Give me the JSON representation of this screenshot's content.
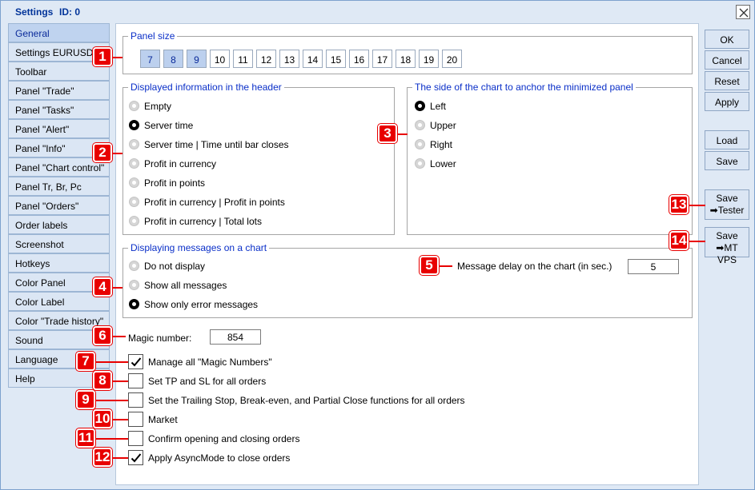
{
  "window": {
    "title": "Settings",
    "id_label": "ID: 0"
  },
  "sidebar": {
    "items": [
      {
        "label": "General",
        "active": true
      },
      {
        "label": "Settings EURUSD"
      },
      {
        "label": "Toolbar"
      },
      {
        "label": "Panel \"Trade\""
      },
      {
        "label": "Panel \"Tasks\""
      },
      {
        "label": "Panel \"Alert\""
      },
      {
        "label": "Panel \"Info\""
      },
      {
        "label": "Panel \"Chart control\""
      },
      {
        "label": "Panel Tr, Br, Pc"
      },
      {
        "label": "Panel \"Orders\""
      },
      {
        "label": "Order labels"
      },
      {
        "label": "Screenshot"
      },
      {
        "label": "Hotkeys"
      },
      {
        "label": "Color Panel"
      },
      {
        "label": "Color Label"
      },
      {
        "label": "Color \"Trade history\""
      },
      {
        "label": "Sound"
      },
      {
        "label": "Language"
      },
      {
        "label": "Help"
      }
    ]
  },
  "panel_size": {
    "title": "Panel size",
    "options": [
      "7",
      "8",
      "9",
      "10",
      "11",
      "12",
      "13",
      "14",
      "15",
      "16",
      "17",
      "18",
      "19",
      "20"
    ],
    "highlighted": [
      "7",
      "8",
      "9"
    ]
  },
  "header_info": {
    "title": "Displayed information in the header",
    "options": [
      "Empty",
      "Server time",
      "Server time | Time until bar closes",
      "Profit in currency",
      "Profit in points",
      "Profit in currency | Profit in points",
      "Profit in currency | Total lots"
    ],
    "selected": "Server time"
  },
  "anchor_side": {
    "title": "The side of the chart to anchor the minimized panel",
    "options": [
      "Left",
      "Upper",
      "Right",
      "Lower"
    ],
    "selected": "Left"
  },
  "messages": {
    "title": "Displaying messages on a chart",
    "options": [
      "Do not display",
      "Show all messages",
      "Show only error messages"
    ],
    "selected": "Show only error messages",
    "delay_label": "Message delay on the chart (in sec.)",
    "delay_value": "5"
  },
  "magic": {
    "label": "Magic number:",
    "value": "854"
  },
  "checkboxes": [
    {
      "label": "Manage all \"Magic Numbers\"",
      "checked": true
    },
    {
      "label": "Set TP and SL for all orders",
      "checked": false
    },
    {
      "label": "Set the Trailing Stop, Break-even, and Partial Close functions for all orders",
      "checked": false
    },
    {
      "label": "Market",
      "checked": false
    },
    {
      "label": "Confirm opening and closing orders",
      "checked": false
    },
    {
      "label": "Apply AsyncMode to close orders",
      "checked": true
    }
  ],
  "buttons": {
    "ok": "OK",
    "cancel": "Cancel",
    "reset": "Reset",
    "apply": "Apply",
    "load": "Load",
    "save": "Save",
    "save_tester_line1": "Save",
    "save_tester_line2": "Tester",
    "save_vps_line1": "Save",
    "save_vps_line2": "MT VPS"
  },
  "callouts": [
    "1",
    "2",
    "3",
    "4",
    "5",
    "6",
    "7",
    "8",
    "9",
    "10",
    "11",
    "12",
    "13",
    "14"
  ],
  "colors": {
    "accent": "#0a2fc8",
    "badge": "#e80000",
    "tab_bg": "#dbe6f4",
    "tab_active_bg": "#bfd3ef"
  }
}
